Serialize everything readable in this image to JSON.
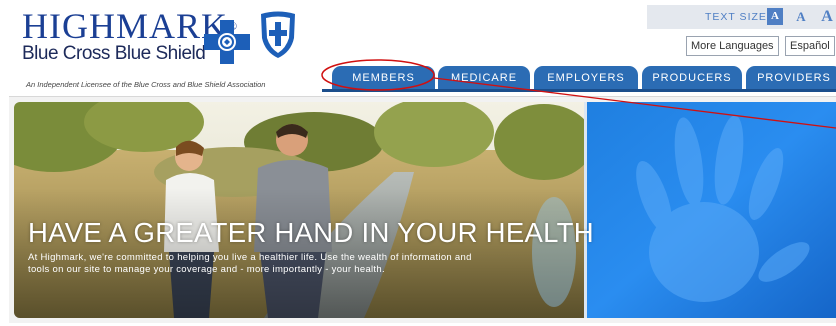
{
  "brand": {
    "name": "HIGHMARK",
    "reg_mark": "®",
    "subtitle": "Blue Cross Blue Shield",
    "tagline": "An Independent Licensee of the Blue Cross and Blue Shield Association",
    "primary_color": "#1b3f94",
    "accent_color": "#2b6cb4"
  },
  "utility": {
    "text_size_label": "TEXT SIZE",
    "text_size_small": "A",
    "text_size_medium": "A",
    "text_size_large": "A",
    "more_languages": "More Languages",
    "espanol": "Español"
  },
  "nav": {
    "members": "MEMBERS",
    "medicare": "MEDICARE",
    "employers": "EMPLOYERS",
    "producers": "PRODUCERS",
    "providers": "PROVIDERS"
  },
  "hero": {
    "headline": "HAVE A GREATER HAND IN YOUR HEALTH",
    "body": "At Highmark, we're committed to helping you live a healthier life. Use the wealth of information and tools on our site to manage your coverage and - more importantly - your health."
  },
  "annotation_color": "#d01010"
}
